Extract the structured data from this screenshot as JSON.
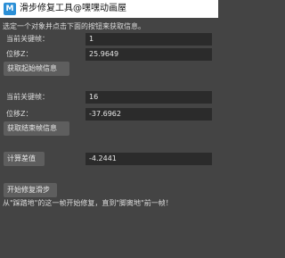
{
  "window": {
    "icon": "M",
    "title": "滑步修复工具@嘿嘿动画屋"
  },
  "instruction": "选定一个对象并点击下面的按钮来获取信息。",
  "start": {
    "frame_label": "当前关键帧：",
    "frame_value": "1",
    "z_label": "位移Z：",
    "z_value": "25.9649",
    "button": "获取起始帧信息"
  },
  "end": {
    "frame_label": "当前关键帧：",
    "frame_value": "16",
    "z_label": "位移Z：",
    "z_value": "-37.6962",
    "button": "获取结束帧信息"
  },
  "diff": {
    "button": "计算差值",
    "value": "-4.2441"
  },
  "fix": {
    "button": "开始修复滑步",
    "hint": "从\"踩踏地\"的这一帧开始修复，直到\"脚离地\"前一帧！"
  }
}
